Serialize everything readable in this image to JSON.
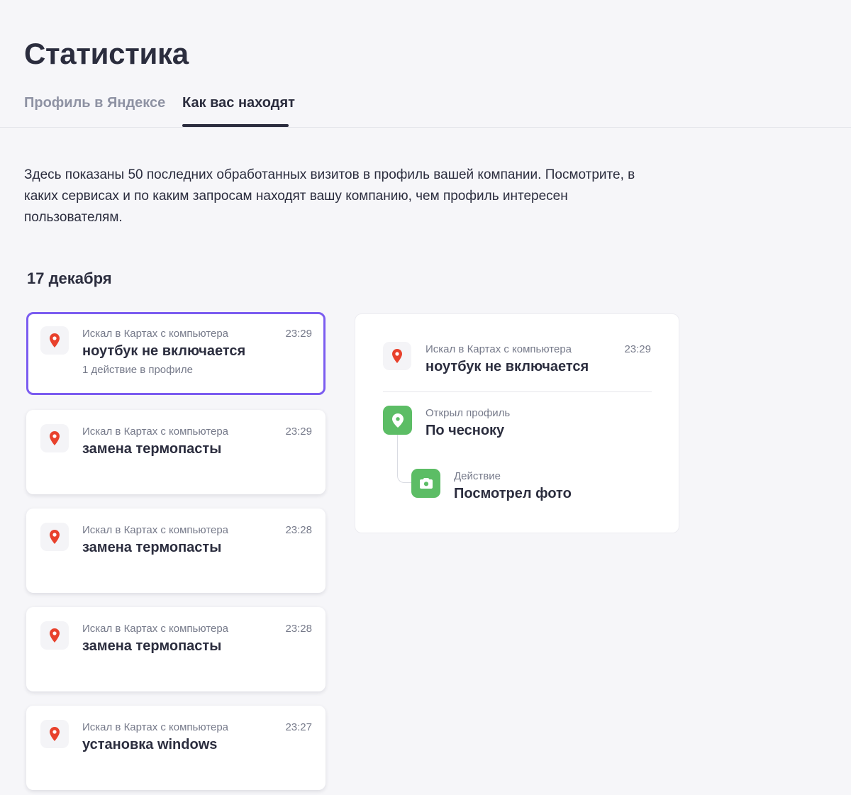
{
  "page": {
    "title": "Статистика"
  },
  "tabs": [
    {
      "label": "Профиль в Яндексе",
      "active": false
    },
    {
      "label": "Как вас находят",
      "active": true
    }
  ],
  "description": "Здесь показаны 50 последних обработанных визитов в профиль вашей компании. Посмотрите, в каких сервисах и по каким запросам находят вашу компанию, чем профиль интересен пользователям.",
  "date_heading": "17 декабря",
  "visits": [
    {
      "source": "Искал в Картах с компьютера",
      "time": "23:29",
      "query": "ноутбук не включается",
      "actions": "1 действие в профиле",
      "selected": true
    },
    {
      "source": "Искал в Картах с компьютера",
      "time": "23:29",
      "query": "замена термопасты",
      "actions": "",
      "selected": false
    },
    {
      "source": "Искал в Картах с компьютера",
      "time": "23:28",
      "query": "замена термопасты",
      "actions": "",
      "selected": false
    },
    {
      "source": "Искал в Картах с компьютера",
      "time": "23:28",
      "query": "замена термопасты",
      "actions": "",
      "selected": false
    },
    {
      "source": "Искал в Картах с компьютера",
      "time": "23:27",
      "query": "установка windows",
      "actions": "",
      "selected": false
    }
  ],
  "detail": {
    "source": "Искал в Картах с компьютера",
    "time": "23:29",
    "query": "ноутбук не включается",
    "steps": [
      {
        "label": "Открыл профиль",
        "value": "По чесноку",
        "icon": "map-pin-icon"
      },
      {
        "label": "Действие",
        "value": "Посмотрел фото",
        "icon": "camera-icon"
      }
    ]
  },
  "colors": {
    "accent": "#7b5cf0",
    "green": "#5cbd65",
    "maps_red": "#e8412c",
    "text": "#2b2d3e",
    "muted": "#767a8a"
  },
  "icons": {
    "visit_source": "yandex-maps-pin-icon"
  }
}
